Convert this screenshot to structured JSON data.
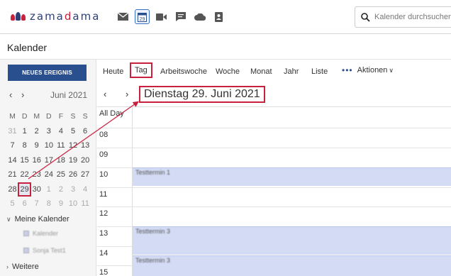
{
  "header": {
    "logo_text_a": "zama",
    "logo_text_b": "d",
    "logo_text_c": "ama",
    "apps": [
      {
        "icon": "mail-icon"
      },
      {
        "icon": "calendar-icon",
        "label": "29",
        "active": true
      },
      {
        "icon": "video-icon"
      },
      {
        "icon": "chat-icon"
      },
      {
        "icon": "cloud-icon"
      },
      {
        "icon": "contacts-icon"
      }
    ],
    "search_placeholder": "Kalender durchsuchen"
  },
  "page_title": "Kalender",
  "sidebar": {
    "new_event_label": "NEUES EREIGNIS",
    "mini_month": "Juni 2021",
    "weekday_heads": [
      "M",
      "D",
      "M",
      "D",
      "F",
      "S",
      "S"
    ],
    "weeks": [
      [
        "31",
        "1",
        "2",
        "3",
        "4",
        "5",
        "6"
      ],
      [
        "7",
        "8",
        "9",
        "10",
        "11",
        "12",
        "13"
      ],
      [
        "14",
        "15",
        "16",
        "17",
        "18",
        "19",
        "20"
      ],
      [
        "21",
        "22",
        "23",
        "24",
        "25",
        "26",
        "27"
      ],
      [
        "28",
        "29",
        "30",
        "1",
        "2",
        "3",
        "4"
      ],
      [
        "5",
        "6",
        "7",
        "8",
        "9",
        "10",
        "11"
      ]
    ],
    "my_calendars_label": "Meine Kalender",
    "calendar_items": [
      "Kalender",
      "Sonja Test1"
    ],
    "more_label": "Weitere"
  },
  "views": {
    "today": "Heute",
    "day": "Tag",
    "workweek": "Arbeitswoche",
    "week": "Woche",
    "month": "Monat",
    "year": "Jahr",
    "list": "Liste",
    "actions": "Aktionen"
  },
  "current_date": "Dienstag 29. Juni 2021",
  "day_view": {
    "all_day_label": "All Day",
    "hours": [
      "08",
      "09",
      "10",
      "11",
      "12",
      "13",
      "14",
      "15"
    ],
    "events": [
      "Testtermin 1",
      "Testtermin 3",
      "Testtermin 3"
    ]
  },
  "colors": {
    "brand_blue": "#2a4f8e",
    "highlight_red": "#c8213d",
    "event_fill": "#d4dcf5"
  }
}
